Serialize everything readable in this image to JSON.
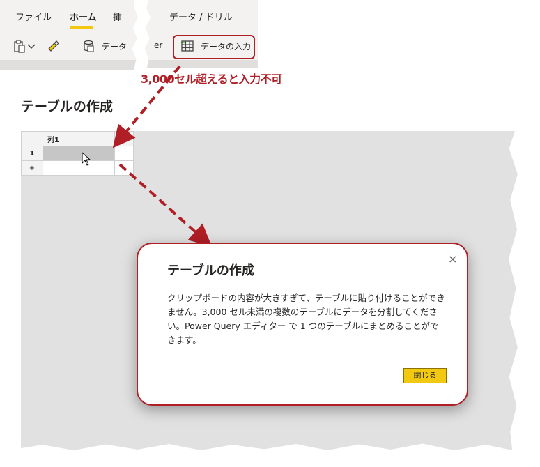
{
  "ribbon": {
    "tabs": [
      {
        "label": "ファイル"
      },
      {
        "label": "ホーム"
      },
      {
        "label": "挿"
      },
      {
        "label": "データ / ドリル"
      }
    ],
    "tools": {
      "data_label_partial": "データ",
      "er_label_partial": "er",
      "enter_data_label": "データの入力"
    }
  },
  "window": {
    "title": "テーブルの作成",
    "grid": {
      "column_header": "列1",
      "row_number": "1",
      "add_row": "+"
    }
  },
  "annotation": {
    "text": "3,000セル超えると入力不可",
    "color": "#b01e26"
  },
  "dialog": {
    "title": "テーブルの作成",
    "close_icon": "×",
    "message": "クリップボードの内容が大きすぎて、テーブルに貼り付けることができません。3,000 セル未満の複数のテーブルにデータを分割してください。Power Query エディター で 1 つのテーブルにまとめることができます。",
    "close_button": "閉じる"
  },
  "colors": {
    "accent": "#f2c811",
    "highlight": "#b01e26"
  }
}
